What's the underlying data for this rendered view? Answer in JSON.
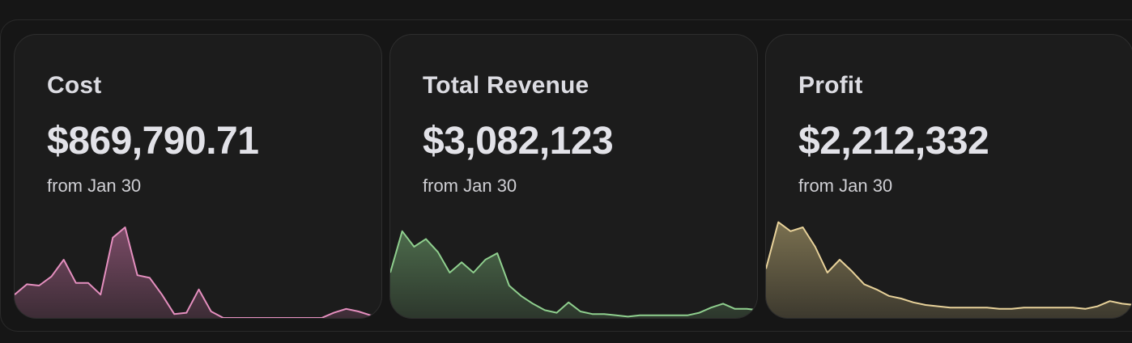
{
  "cards": [
    {
      "title": "Cost",
      "value": "$869,790.71",
      "subtitle": "from Jan 30",
      "line_color": "#e58fbf",
      "fill_color": "#7a4b66",
      "series": [
        18,
        26,
        25,
        32,
        45,
        27,
        27,
        18,
        62,
        70,
        33,
        31,
        18,
        3,
        4,
        22,
        5,
        0,
        0,
        0,
        0,
        0,
        0,
        0,
        0,
        0,
        4,
        7,
        5,
        2,
        2
      ]
    },
    {
      "title": "Total Revenue",
      "value": "$3,082,123",
      "subtitle": "from Jan 30",
      "line_color": "#8fcf8e",
      "fill_color": "#4c6a4b",
      "series": [
        35,
        67,
        55,
        61,
        51,
        35,
        43,
        35,
        45,
        50,
        25,
        17,
        11,
        6,
        4,
        12,
        5,
        3,
        3,
        2,
        1,
        2,
        2,
        2,
        2,
        2,
        4,
        8,
        11,
        7,
        7,
        6
      ]
    },
    {
      "title": "Profit",
      "value": "$2,212,332",
      "subtitle": "from Jan 30",
      "line_color": "#e8d29a",
      "fill_color": "#7a7050",
      "series": [
        38,
        74,
        67,
        70,
        55,
        35,
        45,
        36,
        26,
        22,
        17,
        15,
        12,
        10,
        9,
        8,
        8,
        8,
        8,
        7,
        7,
        8,
        8,
        8,
        8,
        8,
        7,
        9,
        13,
        11,
        10
      ]
    }
  ]
}
